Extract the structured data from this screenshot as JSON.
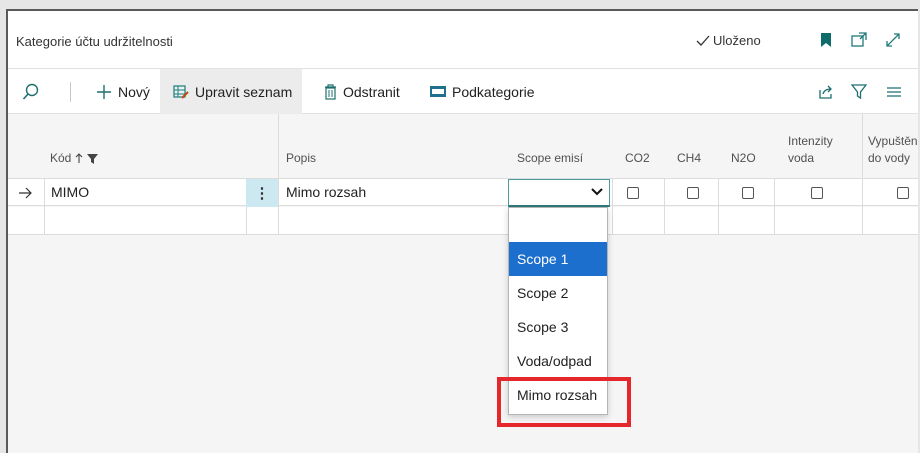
{
  "window": {
    "title": "Kategorie účtu udržitelnosti",
    "saved_label": "Uloženo"
  },
  "icons": {
    "saved": "check-icon",
    "bookmark": "bookmark-icon",
    "open_new": "open-new-window-icon",
    "expand": "expand-icon",
    "search": "search-icon",
    "new": "plus-icon",
    "edit_list": "edit-list-icon",
    "delete": "trash-icon",
    "subcategories": "subcategory-icon",
    "share": "share-icon",
    "filter": "filter-icon",
    "list": "list-icon"
  },
  "actions": {
    "new_label": "Nový",
    "edit_list_label": "Upravit seznam",
    "delete_label": "Odstranit",
    "subcategories_label": "Podkategorie"
  },
  "columns": {
    "code": "Kód",
    "description": "Popis",
    "scope": "Scope emisí",
    "co2": "CO2",
    "ch4": "CH4",
    "n2o": "N2O",
    "water_intensity_1": "Intenzity",
    "water_intensity_2": "voda",
    "water_discharged_1": "Vypuštěno",
    "water_discharged_2": "do vody"
  },
  "rows": [
    {
      "code": "MIMO",
      "description": "Mimo rozsah",
      "scope": "",
      "co2": false,
      "ch4": false,
      "n2o": false,
      "water_intensity": false,
      "water_discharged": false
    }
  ],
  "scope_dropdown": {
    "options": [
      "",
      "Scope 1",
      "Scope 2",
      "Scope 3",
      "Voda/odpad",
      "Mimo rozsah"
    ],
    "highlighted": "Scope 1",
    "emphasized": "Mimo rozsah"
  },
  "colors": {
    "accent": "#1d6fce",
    "emphasis": "#e5262b",
    "selection": "#cce8f0"
  }
}
